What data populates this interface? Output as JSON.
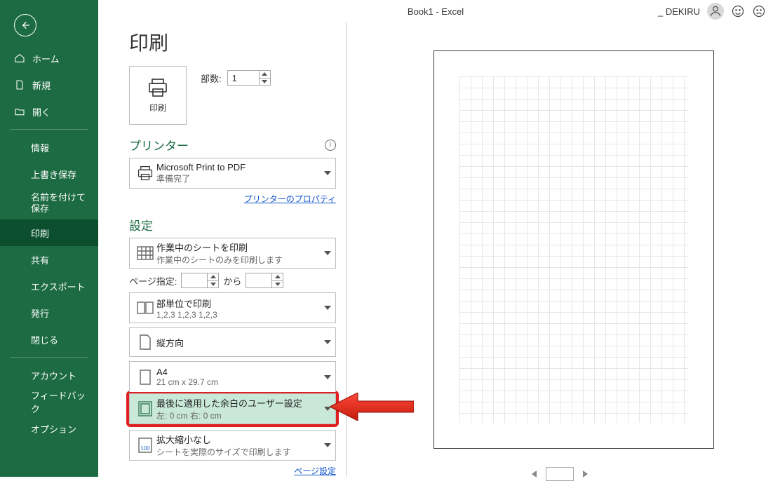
{
  "topbar": {
    "doc_title": "Book1  -  Excel",
    "user_name": "_ DEKIRU"
  },
  "sidebar": {
    "home": "ホーム",
    "new": "新規",
    "open": "開く",
    "info": "情報",
    "save": "上書き保存",
    "saveas": "名前を付けて保存",
    "print": "印刷",
    "share": "共有",
    "export": "エクスポート",
    "publish": "発行",
    "close": "閉じる",
    "account": "アカウント",
    "feedback": "フィードバック",
    "options": "オプション"
  },
  "page": {
    "title": "印刷",
    "print_btn_label": "印刷",
    "copies_label": "部数:",
    "copies_value": "1",
    "printer_heading": "プリンター",
    "printer": {
      "name": "Microsoft Print to PDF",
      "status": "準備完了"
    },
    "printer_props_link": "プリンターのプロパティ",
    "settings_heading": "設定",
    "what": {
      "l1": "作業中のシートを印刷",
      "l2": "作業中のシートのみを印刷します"
    },
    "pages_label": "ページ指定:",
    "pages_to": "から",
    "collate": {
      "l1": "部単位で印刷",
      "l2": "1,2,3    1,2,3    1,2,3"
    },
    "orientation": {
      "l1": "縦方向"
    },
    "paper": {
      "l1": "A4",
      "l2": "21 cm x 29.7 cm"
    },
    "margins": {
      "l1": "最後に適用した余白のユーザー設定",
      "l2": "左:  0 cm    右:  0 cm"
    },
    "scaling": {
      "l1": "拡大縮小なし",
      "l2": "シートを実際のサイズで印刷します"
    },
    "page_setup_link": "ページ設定"
  }
}
